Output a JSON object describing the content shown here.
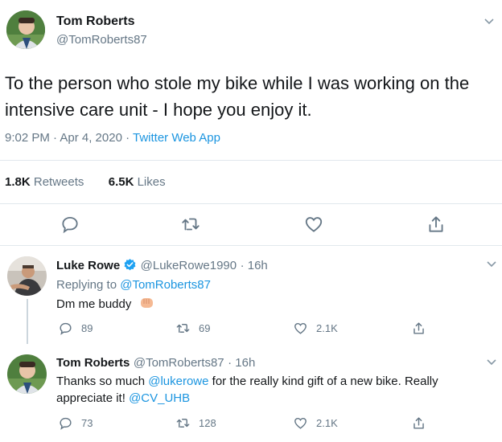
{
  "main_tweet": {
    "author_name": "Tom Roberts",
    "author_handle": "@TomRoberts87",
    "text": "To the person who stole my bike while I was working on the intensive care unit - I hope you enjoy it.",
    "time": "9:02 PM · Apr 4, 2020 · ",
    "source": "Twitter Web App",
    "retweets_count": "1.8K",
    "retweets_label": "Retweets",
    "likes_count": "6.5K",
    "likes_label": "Likes"
  },
  "replies": [
    {
      "author_name": "Luke Rowe",
      "verified": true,
      "author_handle": "@LukeRowe1990",
      "time": "· 16h",
      "replying_prefix": "Replying to ",
      "replying_to": "@TomRoberts87",
      "text": "Dm me buddy",
      "emoji": "fist-emoji",
      "reply_count": "89",
      "retweet_count": "69",
      "like_count": "2.1K"
    },
    {
      "author_name": "Tom Roberts",
      "author_handle": "@TomRoberts87",
      "time": "· 16h",
      "text_part1": "Thanks so much ",
      "mention1": "@lukerowe",
      "text_part2": " for the really kind gift of a new bike. Really",
      "text_part3": "appreciate it! ",
      "mention2": "@CV_UHB",
      "reply_count": "73",
      "retweet_count": "128",
      "like_count": "2.1K"
    }
  ],
  "colors": {
    "text": "#14171a",
    "muted": "#657786",
    "link": "#1b95e0",
    "divider": "#e1e8ed",
    "verified": "#1da1f2"
  },
  "icons": [
    "chevron-down-icon",
    "reply-icon",
    "retweet-icon",
    "like-icon",
    "share-icon",
    "verified-badge-icon"
  ]
}
